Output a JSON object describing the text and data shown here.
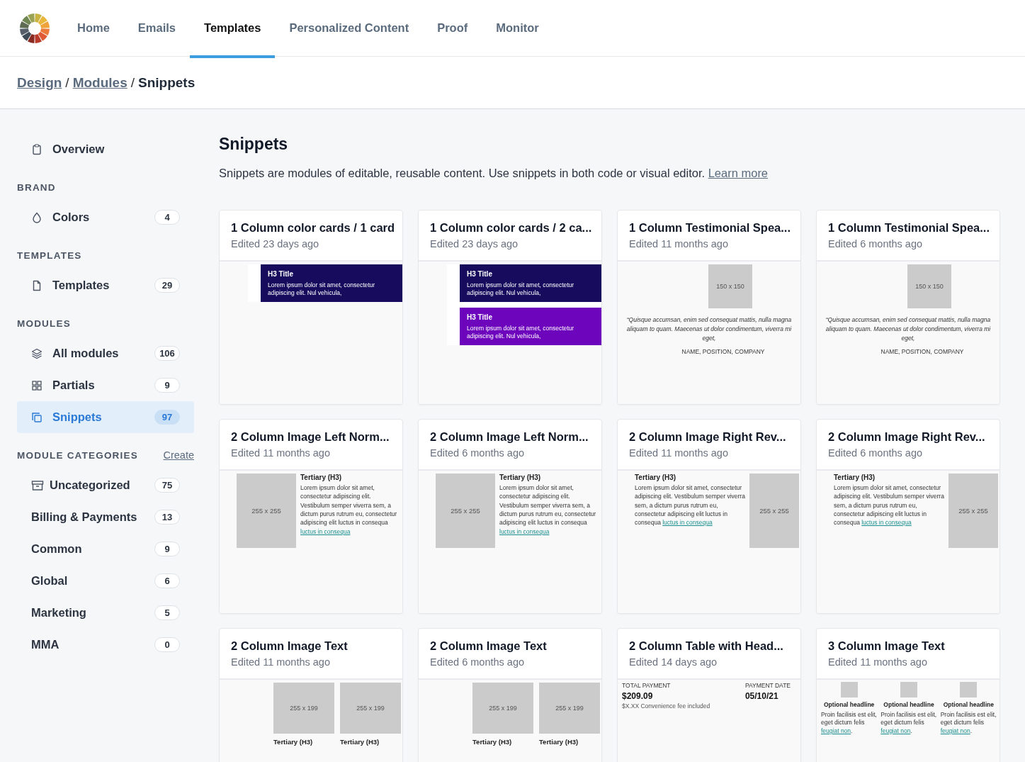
{
  "nav": {
    "items": [
      {
        "label": "Home",
        "selected": false
      },
      {
        "label": "Emails",
        "selected": false
      },
      {
        "label": "Templates",
        "selected": true
      },
      {
        "label": "Personalized Content",
        "selected": false
      },
      {
        "label": "Proof",
        "selected": false
      },
      {
        "label": "Monitor",
        "selected": false
      }
    ]
  },
  "breadcrumb": {
    "parts": [
      {
        "kind": "link",
        "text": "Design"
      },
      {
        "kind": "separator",
        "text": "/"
      },
      {
        "kind": "link",
        "text": "Modules"
      },
      {
        "kind": "separator",
        "text": "/"
      },
      {
        "kind": "current",
        "text": "Snippets"
      }
    ]
  },
  "sidebar": {
    "overview": "Overview",
    "sections": [
      {
        "heading": "BRAND",
        "items": [
          {
            "label": "Colors",
            "count": "4",
            "selected": false
          }
        ]
      },
      {
        "heading": "TEMPLATES",
        "items": [
          {
            "label": "Templates",
            "count": "29",
            "selected": false
          }
        ]
      },
      {
        "heading": "MODULES",
        "items": [
          {
            "label": "All modules",
            "count": "106",
            "selected": false
          },
          {
            "label": "Partials",
            "count": "9",
            "selected": false
          },
          {
            "label": "Snippets",
            "count": "97",
            "selected": true
          }
        ]
      },
      {
        "heading": "MODULE CATEGORIES",
        "action": "Create",
        "items": [
          {
            "label": "Uncategorized",
            "count": "75",
            "selected": false
          },
          {
            "label": "Billing & Payments",
            "count": "13",
            "selected": false
          },
          {
            "label": "Common",
            "count": "9",
            "selected": false
          },
          {
            "label": "Global",
            "count": "6",
            "selected": false
          },
          {
            "label": "Marketing",
            "count": "5",
            "selected": false
          },
          {
            "label": "MMA",
            "count": "0",
            "selected": false
          }
        ]
      }
    ]
  },
  "page": {
    "title": "Snippets",
    "description": "Snippets are modules of editable, reusable content. Use snippets in both code or visual editor.",
    "link": "Learn more"
  },
  "cards": [
    {
      "title": "1 Column color cards / 1 card",
      "edited": "Edited 23 days ago",
      "preview": {
        "kind": "color-cards",
        "blocks": [
          {
            "heading": "H3 Title",
            "body": "Lorem ipsum dolor sit amet, consectetur adipiscing elit. Nul vehicula,",
            "color": "#170b5e"
          }
        ]
      }
    },
    {
      "title": "1 Column color cards / 2 ca...",
      "edited": "Edited 23 days ago",
      "preview": {
        "kind": "color-cards",
        "blocks": [
          {
            "heading": "H3 Title",
            "body": "Lorem ipsum dolor sit amet, consectetur adipiscing elit. Nul vehicula,",
            "color": "#170b5e"
          },
          {
            "heading": "H3 Title",
            "body": "Lorem ipsum dolor sit amet, consectetur adipiscing elit. Nul vehicula,",
            "color": "#6d05bd"
          }
        ]
      }
    },
    {
      "title": "1 Column Testimonial Spea...",
      "edited": "Edited 11 months ago",
      "preview": {
        "kind": "testimonial",
        "image": "150 x 150",
        "quote": "“Quisque accumsan, enim sed consequat mattis, nulla magna aliquam to quam. Maecenas ut dolor condimentum, viverra mi eget,",
        "attribution": "NAME, POSITION, COMPANY"
      }
    },
    {
      "title": "1 Column Testimonial Spea...",
      "edited": "Edited 6 months ago",
      "preview": {
        "kind": "testimonial",
        "image": "150 x 150",
        "quote": "“Quisque accumsan, enim sed consequat mattis, nulla magna aliquam to quam. Maecenas ut dolor condimentum, viverra mi eget,",
        "attribution": "NAME, POSITION, COMPANY"
      }
    },
    {
      "title": "2 Column Image Left Norm...",
      "edited": "Edited 11 months ago",
      "preview": {
        "kind": "image-left",
        "image": "255 x 255",
        "heading": "Tertiary (H3)",
        "body": "Lorem ipsum dolor sit amet, consectetur adipiscing elit. Vestibulum semper viverra sem, a dictum purus rutrum eu, consectetur adipiscing elit luctus in consequa",
        "link": "luctus in consequa"
      }
    },
    {
      "title": "2 Column Image Left Norm...",
      "edited": "Edited 6 months ago",
      "preview": {
        "kind": "image-left",
        "image": "255 x 255",
        "heading": "Tertiary (H3)",
        "body": "Lorem ipsum dolor sit amet, consectetur adipiscing elit. Vestibulum semper viverra sem, a dictum purus rutrum eu, consectetur adipiscing elit luctus in consequa",
        "link": "luctus in consequa"
      }
    },
    {
      "title": "2 Column Image Right Rev...",
      "edited": "Edited 11 months ago",
      "preview": {
        "kind": "image-right",
        "image": "255 x 255",
        "heading": "Tertiary (H3)",
        "body": "Lorem ipsum dolor sit amet, consectetur adipiscing elit. Vestibulum semper viverra sem, a dictum purus rutrum eu, consectetur adipiscing elit luctus in consequa",
        "link": "luctus in consequa"
      }
    },
    {
      "title": "2 Column Image Right Rev...",
      "edited": "Edited 6 months ago",
      "preview": {
        "kind": "image-right",
        "image": "255 x 255",
        "heading": "Tertiary (H3)",
        "body": "Lorem ipsum dolor sit amet, consectetur adipiscing elit. Vestibulum semper viverra sem, a dictum purus rutrum eu, consectetur adipiscing elit luctus in consequa",
        "link": "luctus in consequa"
      }
    },
    {
      "title": "2 Column Image Text",
      "edited": "Edited 11 months ago",
      "preview": {
        "kind": "image-columns",
        "columns": [
          {
            "image": "255 x 199",
            "heading": "Tertiary (H3)"
          },
          {
            "image": "255 x 199",
            "heading": "Tertiary (H3)"
          }
        ]
      }
    },
    {
      "title": "2 Column Image Text",
      "edited": "Edited 6 months ago",
      "preview": {
        "kind": "image-columns",
        "columns": [
          {
            "image": "255 x 199",
            "heading": "Tertiary (H3)"
          },
          {
            "image": "255 x 199",
            "heading": "Tertiary (H3)"
          }
        ]
      }
    },
    {
      "title": "2 Column Table with Head...",
      "edited": "Edited 14 days ago",
      "preview": {
        "kind": "payment",
        "cells": [
          {
            "label": "TOTAL PAYMENT",
            "value": "$209.09",
            "note": "$X.XX Convenience fee included"
          },
          {
            "label": "PAYMENT DATE",
            "value": "05/10/21"
          }
        ]
      }
    },
    {
      "title": "3 Column Image Text",
      "edited": "Edited 11 months ago",
      "preview": {
        "kind": "three-columns",
        "columns": [
          {
            "headline": "Optional headline",
            "body": "Proin facilisis est elit, eget dictum felis",
            "link": "feugiat non",
            "end": "."
          },
          {
            "headline": "Optional headline",
            "body": "Proin facilisis est elit, eget dictum felis",
            "link": "feugiat non",
            "end": "."
          },
          {
            "headline": "Optional headline",
            "body": "Proin facilisis est elit, eget dictum felis",
            "link": "feugiat non",
            "end": "."
          }
        ]
      }
    }
  ]
}
